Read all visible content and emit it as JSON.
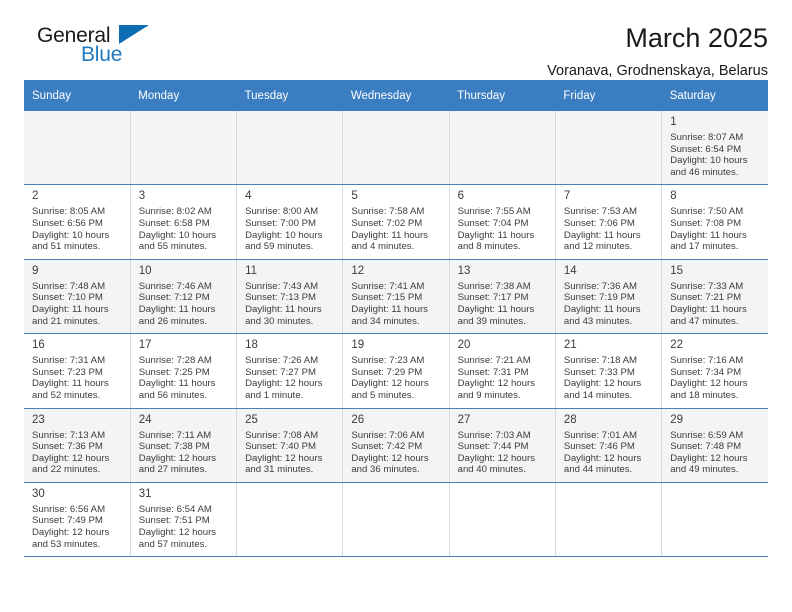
{
  "brand": {
    "name_part1": "General",
    "name_part2": "Blue",
    "accent_color": "#0d6cb4",
    "flag_icon": "triangle-flag-icon"
  },
  "header": {
    "month_title": "March 2025",
    "location": "Voranava, Grodnenskaya, Belarus"
  },
  "calendar": {
    "header_bg": "#3a7dc0",
    "weekdays": [
      "Sunday",
      "Monday",
      "Tuesday",
      "Wednesday",
      "Thursday",
      "Friday",
      "Saturday"
    ],
    "weeks": [
      [
        {
          "day": "",
          "sunrise": "",
          "sunset": "",
          "daylight_line1": "",
          "daylight_line2": ""
        },
        {
          "day": "",
          "sunrise": "",
          "sunset": "",
          "daylight_line1": "",
          "daylight_line2": ""
        },
        {
          "day": "",
          "sunrise": "",
          "sunset": "",
          "daylight_line1": "",
          "daylight_line2": ""
        },
        {
          "day": "",
          "sunrise": "",
          "sunset": "",
          "daylight_line1": "",
          "daylight_line2": ""
        },
        {
          "day": "",
          "sunrise": "",
          "sunset": "",
          "daylight_line1": "",
          "daylight_line2": ""
        },
        {
          "day": "",
          "sunrise": "",
          "sunset": "",
          "daylight_line1": "",
          "daylight_line2": ""
        },
        {
          "day": "1",
          "sunrise": "Sunrise: 8:07 AM",
          "sunset": "Sunset: 6:54 PM",
          "daylight_line1": "Daylight: 10 hours",
          "daylight_line2": "and 46 minutes."
        }
      ],
      [
        {
          "day": "2",
          "sunrise": "Sunrise: 8:05 AM",
          "sunset": "Sunset: 6:56 PM",
          "daylight_line1": "Daylight: 10 hours",
          "daylight_line2": "and 51 minutes."
        },
        {
          "day": "3",
          "sunrise": "Sunrise: 8:02 AM",
          "sunset": "Sunset: 6:58 PM",
          "daylight_line1": "Daylight: 10 hours",
          "daylight_line2": "and 55 minutes."
        },
        {
          "day": "4",
          "sunrise": "Sunrise: 8:00 AM",
          "sunset": "Sunset: 7:00 PM",
          "daylight_line1": "Daylight: 10 hours",
          "daylight_line2": "and 59 minutes."
        },
        {
          "day": "5",
          "sunrise": "Sunrise: 7:58 AM",
          "sunset": "Sunset: 7:02 PM",
          "daylight_line1": "Daylight: 11 hours",
          "daylight_line2": "and 4 minutes."
        },
        {
          "day": "6",
          "sunrise": "Sunrise: 7:55 AM",
          "sunset": "Sunset: 7:04 PM",
          "daylight_line1": "Daylight: 11 hours",
          "daylight_line2": "and 8 minutes."
        },
        {
          "day": "7",
          "sunrise": "Sunrise: 7:53 AM",
          "sunset": "Sunset: 7:06 PM",
          "daylight_line1": "Daylight: 11 hours",
          "daylight_line2": "and 12 minutes."
        },
        {
          "day": "8",
          "sunrise": "Sunrise: 7:50 AM",
          "sunset": "Sunset: 7:08 PM",
          "daylight_line1": "Daylight: 11 hours",
          "daylight_line2": "and 17 minutes."
        }
      ],
      [
        {
          "day": "9",
          "sunrise": "Sunrise: 7:48 AM",
          "sunset": "Sunset: 7:10 PM",
          "daylight_line1": "Daylight: 11 hours",
          "daylight_line2": "and 21 minutes."
        },
        {
          "day": "10",
          "sunrise": "Sunrise: 7:46 AM",
          "sunset": "Sunset: 7:12 PM",
          "daylight_line1": "Daylight: 11 hours",
          "daylight_line2": "and 26 minutes."
        },
        {
          "day": "11",
          "sunrise": "Sunrise: 7:43 AM",
          "sunset": "Sunset: 7:13 PM",
          "daylight_line1": "Daylight: 11 hours",
          "daylight_line2": "and 30 minutes."
        },
        {
          "day": "12",
          "sunrise": "Sunrise: 7:41 AM",
          "sunset": "Sunset: 7:15 PM",
          "daylight_line1": "Daylight: 11 hours",
          "daylight_line2": "and 34 minutes."
        },
        {
          "day": "13",
          "sunrise": "Sunrise: 7:38 AM",
          "sunset": "Sunset: 7:17 PM",
          "daylight_line1": "Daylight: 11 hours",
          "daylight_line2": "and 39 minutes."
        },
        {
          "day": "14",
          "sunrise": "Sunrise: 7:36 AM",
          "sunset": "Sunset: 7:19 PM",
          "daylight_line1": "Daylight: 11 hours",
          "daylight_line2": "and 43 minutes."
        },
        {
          "day": "15",
          "sunrise": "Sunrise: 7:33 AM",
          "sunset": "Sunset: 7:21 PM",
          "daylight_line1": "Daylight: 11 hours",
          "daylight_line2": "and 47 minutes."
        }
      ],
      [
        {
          "day": "16",
          "sunrise": "Sunrise: 7:31 AM",
          "sunset": "Sunset: 7:23 PM",
          "daylight_line1": "Daylight: 11 hours",
          "daylight_line2": "and 52 minutes."
        },
        {
          "day": "17",
          "sunrise": "Sunrise: 7:28 AM",
          "sunset": "Sunset: 7:25 PM",
          "daylight_line1": "Daylight: 11 hours",
          "daylight_line2": "and 56 minutes."
        },
        {
          "day": "18",
          "sunrise": "Sunrise: 7:26 AM",
          "sunset": "Sunset: 7:27 PM",
          "daylight_line1": "Daylight: 12 hours",
          "daylight_line2": "and 1 minute."
        },
        {
          "day": "19",
          "sunrise": "Sunrise: 7:23 AM",
          "sunset": "Sunset: 7:29 PM",
          "daylight_line1": "Daylight: 12 hours",
          "daylight_line2": "and 5 minutes."
        },
        {
          "day": "20",
          "sunrise": "Sunrise: 7:21 AM",
          "sunset": "Sunset: 7:31 PM",
          "daylight_line1": "Daylight: 12 hours",
          "daylight_line2": "and 9 minutes."
        },
        {
          "day": "21",
          "sunrise": "Sunrise: 7:18 AM",
          "sunset": "Sunset: 7:33 PM",
          "daylight_line1": "Daylight: 12 hours",
          "daylight_line2": "and 14 minutes."
        },
        {
          "day": "22",
          "sunrise": "Sunrise: 7:16 AM",
          "sunset": "Sunset: 7:34 PM",
          "daylight_line1": "Daylight: 12 hours",
          "daylight_line2": "and 18 minutes."
        }
      ],
      [
        {
          "day": "23",
          "sunrise": "Sunrise: 7:13 AM",
          "sunset": "Sunset: 7:36 PM",
          "daylight_line1": "Daylight: 12 hours",
          "daylight_line2": "and 22 minutes."
        },
        {
          "day": "24",
          "sunrise": "Sunrise: 7:11 AM",
          "sunset": "Sunset: 7:38 PM",
          "daylight_line1": "Daylight: 12 hours",
          "daylight_line2": "and 27 minutes."
        },
        {
          "day": "25",
          "sunrise": "Sunrise: 7:08 AM",
          "sunset": "Sunset: 7:40 PM",
          "daylight_line1": "Daylight: 12 hours",
          "daylight_line2": "and 31 minutes."
        },
        {
          "day": "26",
          "sunrise": "Sunrise: 7:06 AM",
          "sunset": "Sunset: 7:42 PM",
          "daylight_line1": "Daylight: 12 hours",
          "daylight_line2": "and 36 minutes."
        },
        {
          "day": "27",
          "sunrise": "Sunrise: 7:03 AM",
          "sunset": "Sunset: 7:44 PM",
          "daylight_line1": "Daylight: 12 hours",
          "daylight_line2": "and 40 minutes."
        },
        {
          "day": "28",
          "sunrise": "Sunrise: 7:01 AM",
          "sunset": "Sunset: 7:46 PM",
          "daylight_line1": "Daylight: 12 hours",
          "daylight_line2": "and 44 minutes."
        },
        {
          "day": "29",
          "sunrise": "Sunrise: 6:59 AM",
          "sunset": "Sunset: 7:48 PM",
          "daylight_line1": "Daylight: 12 hours",
          "daylight_line2": "and 49 minutes."
        }
      ],
      [
        {
          "day": "30",
          "sunrise": "Sunrise: 6:56 AM",
          "sunset": "Sunset: 7:49 PM",
          "daylight_line1": "Daylight: 12 hours",
          "daylight_line2": "and 53 minutes."
        },
        {
          "day": "31",
          "sunrise": "Sunrise: 6:54 AM",
          "sunset": "Sunset: 7:51 PM",
          "daylight_line1": "Daylight: 12 hours",
          "daylight_line2": "and 57 minutes."
        },
        {
          "day": "",
          "sunrise": "",
          "sunset": "",
          "daylight_line1": "",
          "daylight_line2": ""
        },
        {
          "day": "",
          "sunrise": "",
          "sunset": "",
          "daylight_line1": "",
          "daylight_line2": ""
        },
        {
          "day": "",
          "sunrise": "",
          "sunset": "",
          "daylight_line1": "",
          "daylight_line2": ""
        },
        {
          "day": "",
          "sunrise": "",
          "sunset": "",
          "daylight_line1": "",
          "daylight_line2": ""
        },
        {
          "day": "",
          "sunrise": "",
          "sunset": "",
          "daylight_line1": "",
          "daylight_line2": ""
        }
      ]
    ]
  }
}
